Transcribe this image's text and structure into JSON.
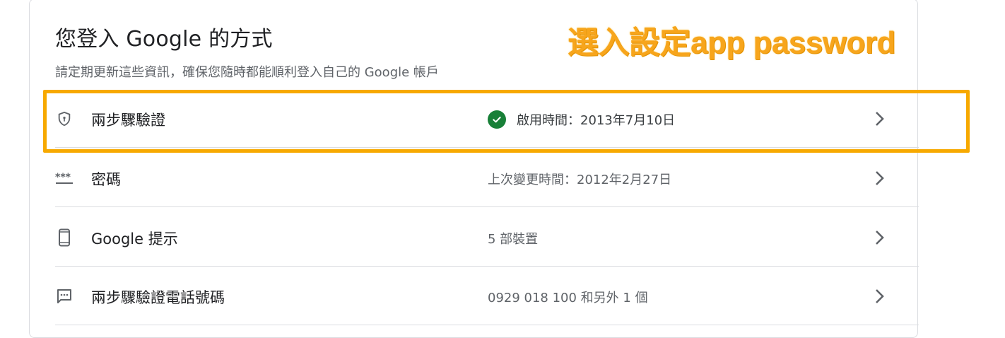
{
  "header": {
    "title": "您登入 Google 的方式",
    "subtitle": "請定期更新這些資訊，確保您隨時都能順利登入自己的 Google 帳戶"
  },
  "annotation": {
    "text": "選入設定app password",
    "color": "#f7a900"
  },
  "rows": [
    {
      "icon": "shield-icon",
      "label": "兩步驟驗證",
      "value": "啟用時間：2013年7月10日",
      "status_icon": "check-circle-icon"
    },
    {
      "icon": "password-asterisk-icon",
      "label": "密碼",
      "value": "上次變更時間：2012年2月27日"
    },
    {
      "icon": "phone-icon",
      "label": "Google 提示",
      "value": "5 部裝置"
    },
    {
      "icon": "message-icon",
      "label": "兩步驟驗證電話號碼",
      "value": "0929 018 100 和另外 1 個"
    }
  ],
  "colors": {
    "accent_check": "#188038",
    "text_primary": "#202124",
    "text_secondary": "#5f6368",
    "divider": "#dadce0"
  }
}
